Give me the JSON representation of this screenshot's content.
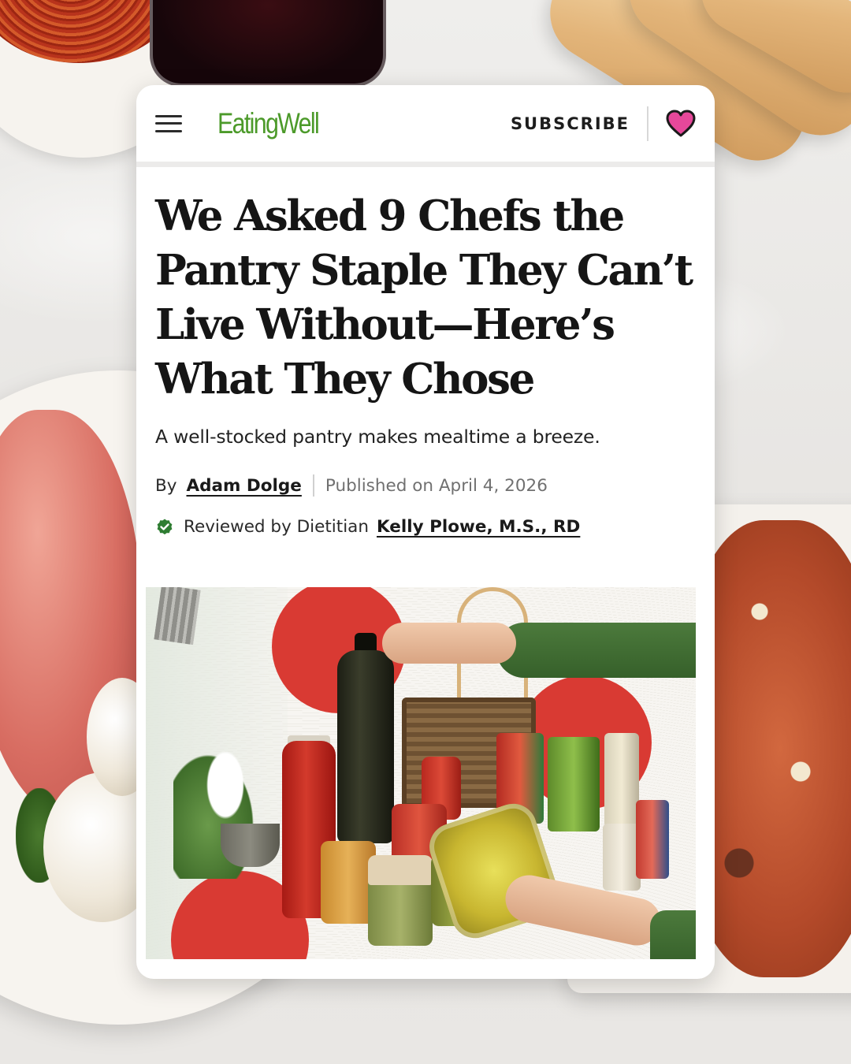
{
  "header": {
    "logo_text": "EatingWell",
    "subscribe_label": "SUBSCRIBE",
    "menu_icon": "hamburger-menu-icon",
    "heart_icon": "heart-icon"
  },
  "article": {
    "headline": "We Asked 9 Chefs the Pantry Staple They Can’t Live Without—Here’s What They Chose",
    "dek": "A well-stocked pantry makes mealtime a breeze.",
    "byline_prefix": "By",
    "author": "Adam Dolge",
    "published": "Published on April 4, 2026",
    "reviewed_prefix": "Reviewed by Dietitian",
    "reviewer": "Kelly Plowe, M.S., RD",
    "verified_icon": "check-badge-icon"
  },
  "colors": {
    "brand_green": "#4c9a2a",
    "heart_pink": "#e6489a",
    "accent_red": "#d93a33",
    "verified_green": "#2e7d32"
  }
}
